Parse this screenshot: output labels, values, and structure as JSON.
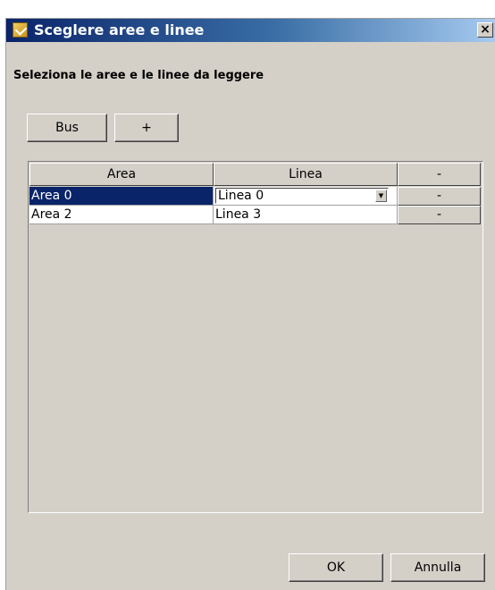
{
  "window": {
    "title": "Sceglere aree e linee",
    "close_label": "×"
  },
  "instruction": "Seleziona le aree e le linee da leggere",
  "toolbar": {
    "bus_label": "Bus",
    "add_label": "+"
  },
  "table": {
    "columns": [
      "Area",
      "Linea",
      "-"
    ],
    "rows": [
      {
        "area": "Area 0",
        "linea": "Linea 0",
        "remove": "-",
        "selected": true,
        "editing": true
      },
      {
        "area": "Area 2",
        "linea": "Linea 3",
        "remove": "-",
        "selected": false,
        "editing": false
      }
    ]
  },
  "footer": {
    "ok_label": "OK",
    "cancel_label": "Annulla"
  },
  "colors": {
    "selection": "#0a246a",
    "dialog_bg": "#d4d0c8"
  },
  "icons": {
    "app": "app-icon",
    "dropdown": "chevron-down-icon"
  }
}
